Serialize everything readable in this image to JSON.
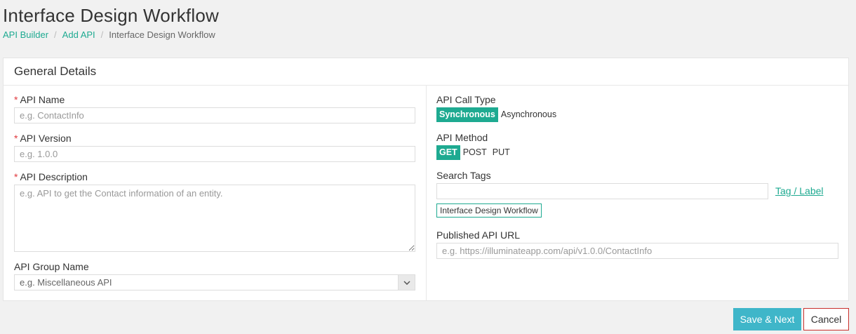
{
  "page": {
    "title": "Interface Design Workflow"
  },
  "breadcrumb": {
    "items": [
      "API Builder",
      "Add API",
      "Interface Design Workflow"
    ],
    "separator": "/"
  },
  "card": {
    "title": "General Details"
  },
  "form": {
    "required_marker": "*",
    "api_name": {
      "label": "API Name",
      "placeholder": "e.g. ContactInfo"
    },
    "api_version": {
      "label": "API Version",
      "placeholder": "e.g. 1.0.0"
    },
    "api_description": {
      "label": "API Description",
      "placeholder": "e.g. API to get the Contact information of an entity."
    },
    "api_group": {
      "label": "API Group Name",
      "value": "e.g. Miscellaneous API"
    },
    "call_type": {
      "label": "API Call Type",
      "options": [
        "Synchronous",
        "Asynchronous"
      ],
      "selected": "Synchronous"
    },
    "method": {
      "label": "API Method",
      "options": [
        "GET",
        "POST",
        "PUT"
      ],
      "selected": "GET"
    },
    "search_tags": {
      "label": "Search Tags",
      "link": "Tag / Label",
      "chips": [
        "Interface Design Workflow"
      ]
    },
    "published_url": {
      "label": "Published API URL",
      "placeholder": "e.g. https://illuminateapp.com/api/v1.0.0/ContactInfo"
    }
  },
  "actions": {
    "save_next": "Save & Next",
    "cancel": "Cancel"
  },
  "colors": {
    "accent": "#1eaa91",
    "primary_button": "#3fb6c9",
    "required": "#e0393e",
    "cancel_border": "#c9302c"
  },
  "icons": {
    "select_arrow": "chevron-down-icon"
  }
}
